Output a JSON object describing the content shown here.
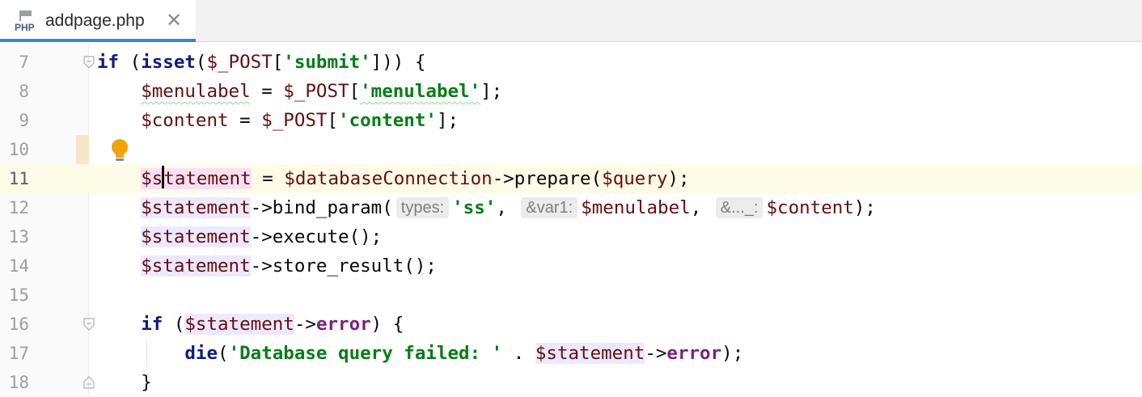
{
  "tab": {
    "file_type": "PHP",
    "file_name": "addpage.php",
    "close_glyph": "✕"
  },
  "colors": {
    "tab_underline": "#4083c9",
    "current_line": "#fefbe7",
    "string": "#067d17",
    "keyword": "#0d1f7a",
    "variable": "#660e0e",
    "highlight": "#ece9ff"
  },
  "lines": [
    {
      "number": "7",
      "t": [
        "if",
        " (",
        "isset",
        "(",
        "$_POST",
        "[",
        "'submit'",
        "])) {"
      ]
    },
    {
      "number": "8",
      "t": [
        "$menulabel",
        " = ",
        "$_POST",
        "[",
        "'menulabel'",
        "];"
      ]
    },
    {
      "number": "9",
      "t": [
        "$content",
        " = ",
        "$_POST",
        "[",
        "'content'",
        "];"
      ]
    },
    {
      "number": "10",
      "t": []
    },
    {
      "number": "11",
      "t": [
        "$s",
        "tatement",
        " = ",
        "$databaseConnection",
        "->prepare(",
        "$query",
        ");"
      ]
    },
    {
      "number": "12",
      "t": [
        "$statement",
        "->bind_param(",
        "types:",
        "'ss'",
        ", ",
        "&var1:",
        "$menulabel",
        ", ",
        "&..._:",
        "$content",
        ");"
      ]
    },
    {
      "number": "13",
      "t": [
        "$statement",
        "->execute();"
      ]
    },
    {
      "number": "14",
      "t": [
        "$statement",
        "->store_result();"
      ]
    },
    {
      "number": "15",
      "t": []
    },
    {
      "number": "16",
      "t": [
        "if",
        " (",
        "$statement",
        "->",
        "error",
        ") {"
      ]
    },
    {
      "number": "17",
      "t": [
        "die",
        "(",
        "'Database query failed: '",
        " . ",
        "$statement",
        "->",
        "error",
        ");"
      ]
    },
    {
      "number": "18",
      "t": [
        "}"
      ]
    }
  ]
}
